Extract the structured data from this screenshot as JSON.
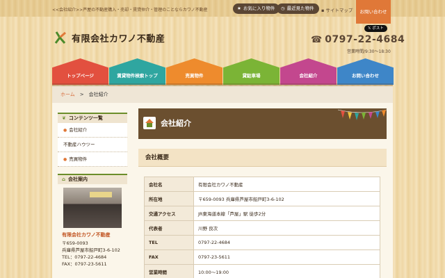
{
  "header": {
    "tagline": "<<会社紹介>>芦屋の不動産購入・売却・賃貸仲介・管理のことならカワノ不動産",
    "favorites_label": "お気に入り物件",
    "recent_label": "最近見た物件",
    "sitemap_label": "サイトマップ",
    "contact_label": "お問い合わせ",
    "post_label": "ポスト",
    "company_name": "有限会社カワノ不動産",
    "phone": "0797-22-4684",
    "hours": "営業時間/9:30〜18:30"
  },
  "nav": [
    {
      "label": "トップページ",
      "color": "#e2503f"
    },
    {
      "label": "賃貸物件検索トップ",
      "color": "#2fa6a0"
    },
    {
      "label": "売買物件",
      "color": "#ee8b2d"
    },
    {
      "label": "貸駐車場",
      "color": "#7bb436"
    },
    {
      "label": "会社紹介",
      "color": "#c3478e"
    },
    {
      "label": "お問い合わせ",
      "color": "#3e86c8"
    }
  ],
  "breadcrumb": {
    "home": "ホーム",
    "separator": ">",
    "current": "会社紹介"
  },
  "sidebar": {
    "contents_title": "コンテンツ一覧",
    "items": [
      "会社紹介",
      "不動産ハウツー",
      "売買物件"
    ],
    "info_title": "会社案内",
    "store_name": "有限会社カワノ不動産",
    "postal": "〒659-0093",
    "address": "兵庫県芦屋市船戸町3-6-102",
    "tel": "TEL：0797-22-4684",
    "fax": "FAX：0797-23-5611"
  },
  "main": {
    "page_title": "会社紹介",
    "section_title": "会社概要",
    "rows": [
      {
        "key": "会社名",
        "value": "有限会社カワノ不動産"
      },
      {
        "key": "所在地",
        "value": "〒659-0093 兵庫県芦屋市船戸町3-6-102"
      },
      {
        "key": "交通アクセス",
        "value": "JR東海道本線「芦屋」駅 徒歩2分"
      },
      {
        "key": "代表者",
        "value": "川野 良次"
      },
      {
        "key": "TEL",
        "value": "0797-22-4684"
      },
      {
        "key": "FAX",
        "value": "0797-23-5611"
      },
      {
        "key": "営業時間",
        "value": "10:00〜19:00"
      }
    ]
  },
  "icons": {
    "star": "★",
    "clock": "◷",
    "sitemap": "▪",
    "phone": "☎",
    "sprout": "❦",
    "arrow": "●",
    "house": "⌂"
  },
  "colors": {
    "accent_orange": "#e07838",
    "brown_dark": "#5b4634",
    "title_brown": "#6b4f2f",
    "sidebar_green": "#6b8e2a"
  }
}
